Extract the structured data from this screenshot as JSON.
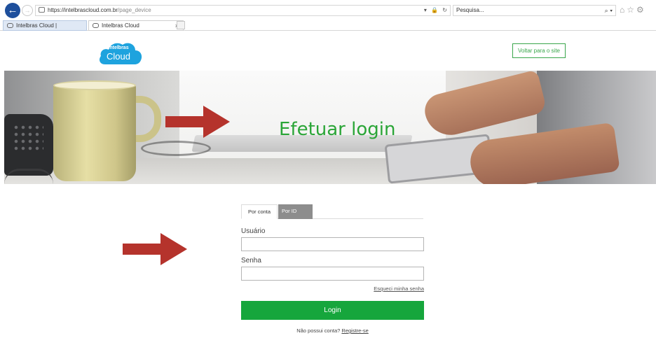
{
  "browser": {
    "url_host": "https://intelbrascloud.com.br",
    "url_path": "/page_device",
    "url_tools": [
      "▾",
      "🔒",
      "↻"
    ],
    "search_placeholder": "Pesquisa...",
    "search_tools": "⌕ ▾",
    "icons": [
      "home-icon",
      "star-icon",
      "gear-icon"
    ],
    "tabs": [
      {
        "label": "Intelbras Cloud |"
      },
      {
        "label": "Intelbras Cloud",
        "close": "×"
      }
    ]
  },
  "header": {
    "logo_line1": "intelbras",
    "logo_line2": "Cloud",
    "back_to_site": "Voltar para o site"
  },
  "hero": {
    "title": "Efetuar login"
  },
  "login": {
    "tabs": [
      {
        "label": "Por conta",
        "active": true
      },
      {
        "label": "Por ID",
        "active": false
      }
    ],
    "user_label": "Usuário",
    "user_value": "",
    "password_label": "Senha",
    "password_value": "",
    "forgot_link": "Esqueci minha senha",
    "login_button": "Login",
    "register_prompt": "Não possui conta?",
    "register_link": "Registre-se"
  },
  "colors": {
    "brand_green": "#16a63c",
    "title_green": "#2aa537",
    "logo_blue": "#1ea3de",
    "arrow_red": "#b5332c"
  }
}
